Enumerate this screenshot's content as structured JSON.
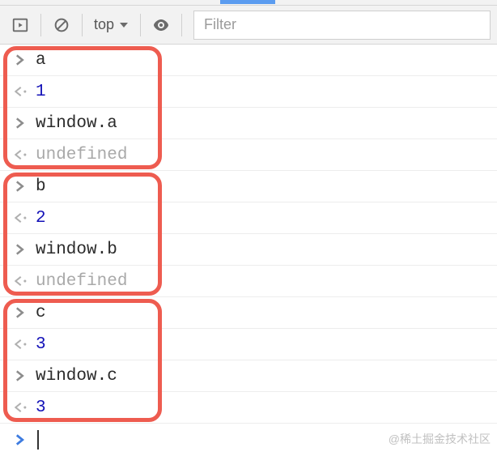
{
  "toolbar": {
    "context_label": "top",
    "filter_placeholder": "Filter"
  },
  "console": {
    "groups": [
      {
        "entries": [
          {
            "kind": "input",
            "text": "a",
            "css": "txt-code"
          },
          {
            "kind": "output",
            "text": "1",
            "css": "txt-num"
          },
          {
            "kind": "input",
            "text": "window.a",
            "css": "txt-code"
          },
          {
            "kind": "output",
            "text": "undefined",
            "css": "txt-undef"
          }
        ]
      },
      {
        "entries": [
          {
            "kind": "input",
            "text": "b",
            "css": "txt-code"
          },
          {
            "kind": "output",
            "text": "2",
            "css": "txt-num"
          },
          {
            "kind": "input",
            "text": "window.b",
            "css": "txt-code"
          },
          {
            "kind": "output",
            "text": "undefined",
            "css": "txt-undef"
          }
        ]
      },
      {
        "entries": [
          {
            "kind": "input",
            "text": "c",
            "css": "txt-code"
          },
          {
            "kind": "output",
            "text": "3",
            "css": "txt-num"
          },
          {
            "kind": "input",
            "text": "window.c",
            "css": "txt-code"
          },
          {
            "kind": "output",
            "text": "3",
            "css": "txt-num"
          }
        ]
      }
    ]
  },
  "watermark": "@稀土掘金技术社区"
}
